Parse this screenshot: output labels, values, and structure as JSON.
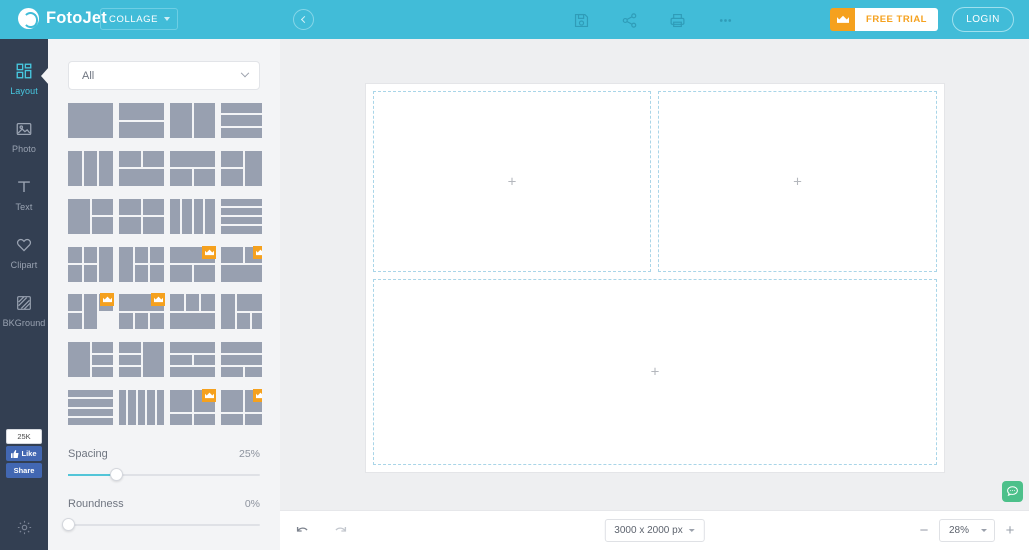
{
  "header": {
    "logo_text": "FotoJet",
    "logo_icon": "fotojet-logo-icon",
    "mode_select": "COLLAGE",
    "collapse_icon": "chevron-left-circle-icon",
    "tools": [
      {
        "name": "save-icon",
        "label": "Save"
      },
      {
        "name": "share-icon",
        "label": "Share"
      },
      {
        "name": "print-icon",
        "label": "Print"
      },
      {
        "name": "more-icon",
        "label": "More"
      }
    ],
    "free_trial": "FREE TRIAL",
    "crown_icon": "crown-icon",
    "login": "LOGIN"
  },
  "rail": {
    "items": [
      {
        "label": "Layout",
        "icon": "layout-grid-icon",
        "active": true
      },
      {
        "label": "Photo",
        "icon": "photo-image-icon",
        "active": false
      },
      {
        "label": "Text",
        "icon": "text-t-icon",
        "active": false
      },
      {
        "label": "Clipart",
        "icon": "heart-icon",
        "active": false
      },
      {
        "label": "BKGround",
        "icon": "background-pattern-icon",
        "active": false
      }
    ],
    "facebook": {
      "count": "25K",
      "like": "Like",
      "share": "Share",
      "thumb_icon": "thumbs-up-icon"
    },
    "settings_icon": "gear-icon"
  },
  "panel": {
    "filter_value": "All",
    "filter_icon": "chevron-down-icon",
    "spacing": {
      "label": "Spacing",
      "value": "25%",
      "percent": 25
    },
    "roundness": {
      "label": "Roundness",
      "value": "0%",
      "percent": 0
    },
    "layouts": [
      {
        "cols": "1fr",
        "rows": "1fr",
        "cells": [
          [
            1,
            1
          ]
        ],
        "premium": false
      },
      {
        "cols": "1fr",
        "rows": "1fr 1fr",
        "cells": [
          [
            1,
            1
          ],
          [
            1,
            1
          ]
        ],
        "premium": false
      },
      {
        "cols": "1fr 1fr",
        "rows": "1fr",
        "cells": [
          [
            1,
            1
          ],
          [
            1,
            1
          ]
        ],
        "premium": false
      },
      {
        "cols": "1fr",
        "rows": "1fr 1fr 1fr",
        "cells": [
          [
            1,
            1
          ],
          [
            1,
            1
          ],
          [
            1,
            1
          ]
        ],
        "premium": false
      },
      {
        "cols": "1fr 1fr 1fr",
        "rows": "1fr",
        "cells": [
          [
            1,
            1
          ],
          [
            1,
            1
          ],
          [
            1,
            1
          ]
        ],
        "premium": false
      },
      {
        "cols": "1fr 1fr",
        "rows": "1fr 1fr",
        "cells": [
          [
            1,
            1
          ],
          [
            1,
            1
          ],
          [
            2,
            1
          ]
        ],
        "premium": false
      },
      {
        "cols": "1fr 1fr",
        "rows": "1fr 1fr",
        "cells": [
          [
            2,
            1
          ],
          [
            1,
            1
          ],
          [
            1,
            1
          ]
        ],
        "premium": false
      },
      {
        "cols": "1fr 1fr",
        "rows": "1fr 1fr",
        "cells": [
          [
            1,
            1
          ],
          [
            1,
            2
          ],
          [
            1,
            1
          ]
        ],
        "premium": false
      },
      {
        "cols": "1fr 1fr",
        "rows": "1fr 1fr",
        "cells": [
          [
            1,
            2
          ],
          [
            1,
            1
          ],
          [
            1,
            1
          ]
        ],
        "premium": false
      },
      {
        "cols": "1fr 1fr",
        "rows": "1fr 1fr",
        "cells": [
          [
            1,
            1
          ],
          [
            1,
            1
          ],
          [
            1,
            1
          ],
          [
            1,
            1
          ]
        ],
        "premium": false
      },
      {
        "cols": "1fr 1fr 1fr 1fr",
        "rows": "1fr",
        "cells": [
          [
            1,
            1
          ],
          [
            1,
            1
          ],
          [
            1,
            1
          ],
          [
            1,
            1
          ]
        ],
        "premium": false
      },
      {
        "cols": "1fr",
        "rows": "1fr 1fr 1fr 1fr",
        "cells": [
          [
            1,
            1
          ],
          [
            1,
            1
          ],
          [
            1,
            1
          ],
          [
            1,
            1
          ]
        ],
        "premium": false
      },
      {
        "cols": "1fr 1fr 1fr",
        "rows": "1fr 1fr",
        "cells": [
          [
            1,
            1
          ],
          [
            1,
            1
          ],
          [
            1,
            2
          ],
          [
            1,
            1
          ],
          [
            1,
            1
          ]
        ],
        "premium": false
      },
      {
        "cols": "1fr 1fr 1fr",
        "rows": "1fr 1fr",
        "cells": [
          [
            1,
            2
          ],
          [
            1,
            1
          ],
          [
            1,
            1
          ],
          [
            1,
            1
          ],
          [
            1,
            1
          ]
        ],
        "premium": false
      },
      {
        "cols": "1fr 1fr",
        "rows": "1fr 1fr",
        "cells": [
          [
            2,
            1
          ],
          [
            1,
            1
          ],
          [
            1,
            1
          ]
        ],
        "premium": true
      },
      {
        "cols": "1fr 1fr",
        "rows": "1fr 1fr",
        "cells": [
          [
            1,
            1
          ],
          [
            1,
            1
          ],
          [
            2,
            1
          ]
        ],
        "premium": true
      },
      {
        "cols": "1fr 1fr 1fr",
        "rows": "1fr 1fr",
        "cells": [
          [
            1,
            1
          ],
          [
            1,
            2
          ],
          [
            1,
            1
          ],
          [
            1,
            1
          ]
        ],
        "premium": true
      },
      {
        "cols": "1fr 1fr 1fr",
        "rows": "1fr 1fr",
        "cells": [
          [
            3,
            1
          ],
          [
            1,
            1
          ],
          [
            1,
            1
          ],
          [
            1,
            1
          ]
        ],
        "premium": true
      },
      {
        "cols": "1fr 1fr 1fr",
        "rows": "1fr 1fr",
        "cells": [
          [
            1,
            1
          ],
          [
            1,
            1
          ],
          [
            1,
            1
          ],
          [
            3,
            1
          ]
        ],
        "premium": false
      },
      {
        "cols": "1fr 1fr 1fr",
        "rows": "1fr 1fr",
        "cells": [
          [
            1,
            2
          ],
          [
            2,
            1
          ],
          [
            1,
            1
          ],
          [
            1,
            1
          ]
        ],
        "premium": false
      },
      {
        "cols": "1fr 1fr",
        "rows": "1fr 1fr 1fr",
        "cells": [
          [
            1,
            3
          ],
          [
            1,
            1
          ],
          [
            1,
            1
          ],
          [
            1,
            1
          ]
        ],
        "premium": false
      },
      {
        "cols": "1fr 1fr",
        "rows": "1fr 1fr 1fr",
        "cells": [
          [
            1,
            1
          ],
          [
            1,
            3
          ],
          [
            1,
            1
          ],
          [
            1,
            1
          ]
        ],
        "premium": false
      },
      {
        "cols": "1fr 1fr",
        "rows": "1fr 1fr 1fr",
        "cells": [
          [
            2,
            1
          ],
          [
            1,
            1
          ],
          [
            1,
            1
          ],
          [
            2,
            1
          ]
        ],
        "premium": false
      },
      {
        "cols": "1fr 1fr",
        "rows": "1fr 1fr 1fr",
        "cells": [
          [
            2,
            1
          ],
          [
            2,
            1
          ],
          [
            1,
            1
          ],
          [
            1,
            1
          ]
        ],
        "premium": false
      },
      {
        "cols": "1fr",
        "rows": "1fr 1fr 1fr 1fr",
        "cells": [
          [
            1,
            1
          ],
          [
            1,
            1
          ],
          [
            1,
            1
          ],
          [
            1,
            1
          ]
        ],
        "premium": false
      },
      {
        "cols": "1fr 1fr 1fr 1fr 1fr",
        "rows": "1fr",
        "cells": [
          [
            1,
            1
          ],
          [
            1,
            1
          ],
          [
            1,
            1
          ],
          [
            1,
            1
          ],
          [
            1,
            1
          ]
        ],
        "premium": false
      },
      {
        "cols": "1fr 1fr",
        "rows": "2fr 1fr",
        "cells": [
          [
            1,
            1
          ],
          [
            1,
            1
          ],
          [
            1,
            1
          ],
          [
            1,
            1
          ]
        ],
        "premium": true
      },
      {
        "cols": "1fr 1fr",
        "rows": "2fr 1fr",
        "cells": [
          [
            1,
            1
          ],
          [
            1,
            1
          ],
          [
            1,
            1
          ],
          [
            1,
            1
          ]
        ],
        "premium": true
      }
    ]
  },
  "canvas": {
    "placeholder_icon": "plus-icon",
    "cells": [
      {
        "name": "canvas-cell-1",
        "plus": "+"
      },
      {
        "name": "canvas-cell-2",
        "plus": "+"
      },
      {
        "name": "canvas-cell-3",
        "plus": "+"
      }
    ]
  },
  "bottombar": {
    "undo_icon": "undo-arrow-icon",
    "redo_icon": "redo-arrow-icon",
    "canvas_size": "3000 x 2000 px",
    "zoom_minus": "−",
    "zoom_value": "28%",
    "zoom_plus": "+"
  },
  "chat": {
    "icon": "chat-bubble-icon"
  },
  "colors": {
    "header": "#41bcd8",
    "rail": "#333f52",
    "panel": "#f3f4f6",
    "accent": "#47c8e0",
    "premium": "#f5a11e",
    "thumb_cell": "#98a0b0",
    "chat": "#4cc08a"
  }
}
